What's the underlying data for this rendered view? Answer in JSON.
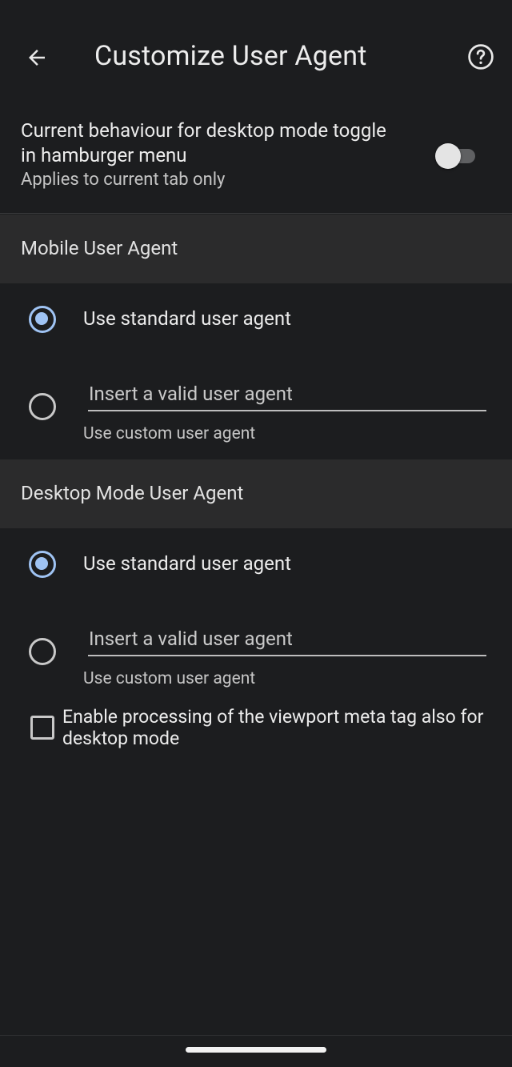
{
  "appbar": {
    "title": "Customize User Agent",
    "back_icon": "arrow-back-icon",
    "help_icon": "help-circle-icon"
  },
  "behaviour": {
    "title": "Current behaviour for desktop mode toggle in hamburger menu",
    "subtitle": "Applies to current tab only",
    "toggle_on": false
  },
  "mobile": {
    "header": "Mobile User Agent",
    "standard_label": "Use standard user agent",
    "standard_selected": true,
    "custom_placeholder": "Insert a valid user agent",
    "custom_value": "",
    "custom_helper": "Use custom user agent"
  },
  "desktop": {
    "header": "Desktop Mode User Agent",
    "standard_label": "Use standard user agent",
    "standard_selected": true,
    "custom_placeholder": "Insert a valid user agent",
    "custom_value": "",
    "custom_helper": "Use custom user agent",
    "viewport_label": "Enable processing of the viewport meta tag also for desktop mode",
    "viewport_checked": false
  },
  "colors": {
    "background": "#1c1d1f",
    "section_header": "#2b2b2c",
    "accent": "#9fc3f3",
    "text_primary": "#ececec",
    "text_secondary": "#c4c4c4"
  }
}
